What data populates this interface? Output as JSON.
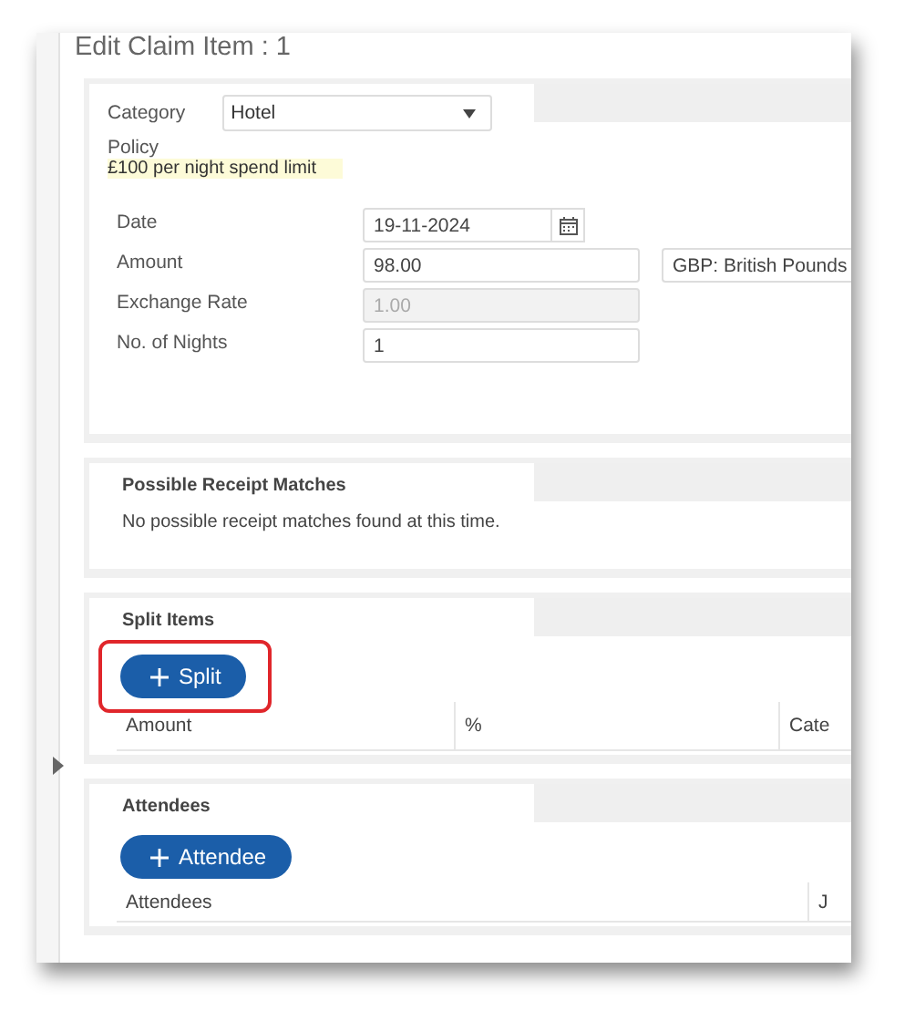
{
  "window": {
    "title": "Edit Claim Item : 1"
  },
  "category": {
    "label": "Category",
    "value": "Hotel"
  },
  "policy": {
    "label": "Policy",
    "text": "£100 per night spend limit"
  },
  "fields": [
    {
      "label": "Date",
      "value": "19-11-2024",
      "kind": "date",
      "disabled": false
    },
    {
      "label": "Amount",
      "value": "98.00",
      "kind": "amount",
      "disabled": false,
      "currency": "GBP: British Pounds"
    },
    {
      "label": "Exchange Rate",
      "value": "1.00",
      "kind": "text",
      "disabled": true
    },
    {
      "label": "No. of Nights",
      "value": "1",
      "kind": "text",
      "disabled": false
    }
  ],
  "receipt_matches": {
    "title": "Possible Receipt Matches",
    "message": "No possible receipt matches found at this time."
  },
  "split_items": {
    "title": "Split Items",
    "button": "Split",
    "highlighted": true,
    "columns": [
      "Amount",
      "%",
      "Cate"
    ]
  },
  "attendees": {
    "title": "Attendees",
    "button": "Attendee",
    "highlighted": false,
    "columns": [
      "Attendees",
      "J"
    ]
  }
}
